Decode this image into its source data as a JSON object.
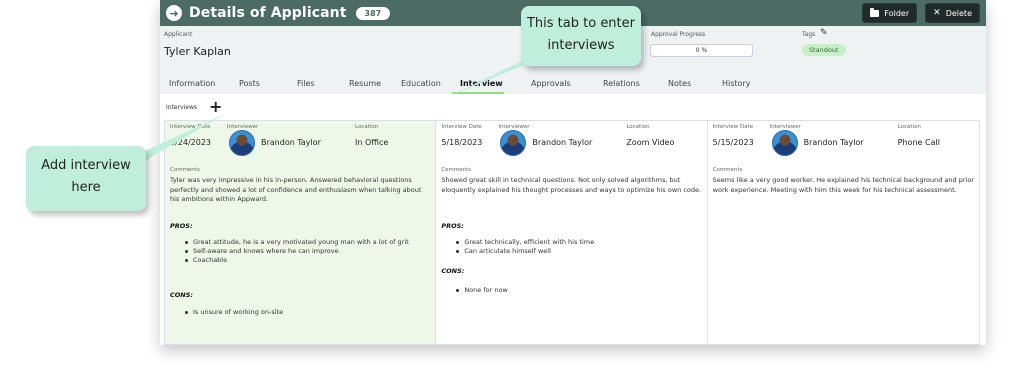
{
  "window": {
    "title": "Details of Applicant",
    "badge": "387",
    "folder_label": "Folder",
    "delete_label": "Delete"
  },
  "header": {
    "applicant_label": "Applicant",
    "applicant_name": "Tyler Kaplan",
    "approval_label": "Approval Progress",
    "approval_value": "0 %",
    "tags_label": "Tags",
    "tag": "Standout"
  },
  "tabs": [
    {
      "label": "Information"
    },
    {
      "label": "Posts"
    },
    {
      "label": "Files"
    },
    {
      "label": "Resume"
    },
    {
      "label": "Education"
    },
    {
      "label": "Interview"
    },
    {
      "label": "Approvals"
    },
    {
      "label": "Relations"
    },
    {
      "label": "Notes"
    },
    {
      "label": "History"
    }
  ],
  "interviews": {
    "label": "Interviews",
    "labels": {
      "date": "Interview Date",
      "interviewer": "Interviewer",
      "location": "Location",
      "comments": "Comments",
      "pros": "PROS:",
      "cons": "CONS:"
    },
    "cards": [
      {
        "date": "5/24/2023",
        "interviewer": "Brandon Taylor",
        "location": "In Office",
        "comments": "Tyler was very impressive in his in-person. Answered behavioral questions perfectly and showed a lot of confidence and enthusiasm when talking about his ambitions within Appward.",
        "pros": [
          "Great attitude, he is a very motivated young man with a lot of grit",
          "Self-aware and knows where he can improve",
          "Coachable"
        ],
        "cons": [
          "Is unsure of working on-site"
        ]
      },
      {
        "date": "5/18/2023",
        "interviewer": "Brandon Taylor",
        "location": "Zoom Video",
        "comments": "Showed great skill in technical questions. Not only solved algorithms, but eloquently explained his thought processes and ways to optimize his own code.",
        "pros": [
          "Great technically, efficient with his time",
          "Can articulate himself well"
        ],
        "cons": [
          "None for now"
        ]
      },
      {
        "date": "5/15/2023",
        "interviewer": "Brandon Taylor",
        "location": "Phone Call",
        "comments": "Seems like a very good worker. He explained his technical background and prior work experience. Meeting with him this week for his technical assessment.",
        "pros": [],
        "cons": []
      }
    ]
  },
  "callouts": {
    "tab_tip": "This tab to enter interviews",
    "add_tip": "Add interview here"
  }
}
